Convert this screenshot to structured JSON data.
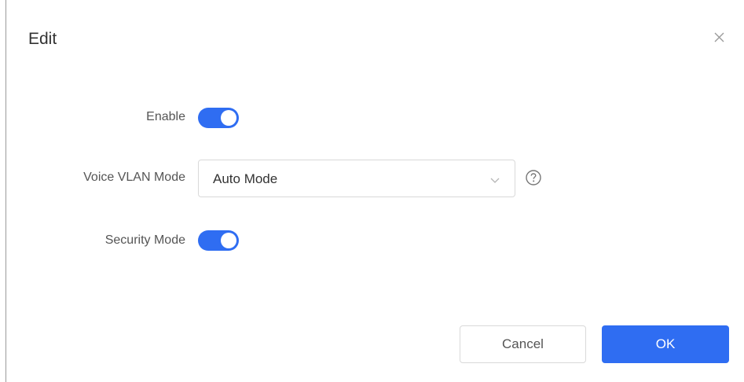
{
  "dialog": {
    "title": "Edit",
    "close_icon": "close-icon"
  },
  "form": {
    "enable": {
      "label": "Enable",
      "on": true
    },
    "voice_vlan_mode": {
      "label": "Voice VLAN Mode",
      "value": "Auto Mode",
      "icon": "chevron-down-icon",
      "help_icon": "help-circle-icon"
    },
    "security_mode": {
      "label": "Security Mode",
      "on": true
    }
  },
  "footer": {
    "cancel_label": "Cancel",
    "ok_label": "OK"
  },
  "colors": {
    "accent": "#2f6df2",
    "border": "#d9d9d9",
    "text": "#333333",
    "label": "#555555"
  }
}
